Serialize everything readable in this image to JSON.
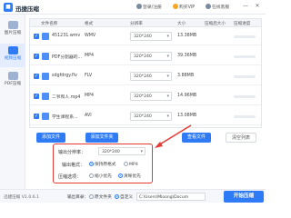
{
  "app": {
    "logo_glyph": "■",
    "title": "迅捷压缩",
    "actions": [
      "登录/注册",
      "购买VIP",
      "在线客服"
    ],
    "win_min": "—",
    "win_close": "✕"
  },
  "sidebar": {
    "items": [
      {
        "label": "图片压缩",
        "icon": "image-icon",
        "active": false
      },
      {
        "label": "视频压缩",
        "icon": "video-icon",
        "active": true
      },
      {
        "label": "PDF压缩",
        "icon": "pdf-icon",
        "active": false
      }
    ]
  },
  "table": {
    "headers": [
      "文件名称",
      "格式",
      "分辨率",
      "大小",
      "压缩后大小",
      "压缩进度"
    ],
    "rows": [
      {
        "check": "✓",
        "name": "451231.wmv",
        "format": "WMV",
        "resolution": "320*240",
        "size": "13.38MB"
      },
      {
        "check": "✓",
        "name": "PDF分割器的...",
        "format": "MP4",
        "resolution": "320*240",
        "size": "39.36MB"
      },
      {
        "check": "✓",
        "name": "sdgfdrgy.flv",
        "format": "FLV",
        "resolution": "320*240",
        "size": "3.88MB"
      },
      {
        "check": "✓",
        "name": "二爷和人.mp4",
        "format": "MP4",
        "resolution": "320*240",
        "size": "14.96MB"
      },
      {
        "check": "✓",
        "name": "学生课程系...",
        "format": "AVI",
        "resolution": "320*240",
        "size": "13.08MB"
      }
    ],
    "dropdown_arrow": "▾"
  },
  "buttons": {
    "add_file": "添加文件",
    "add_folder": "添加文件夹",
    "view_file": "查看文件",
    "clear_list": "清空列表"
  },
  "settings": {
    "resolution_label": "输出分辨率：",
    "resolution_value": "320*240",
    "format_label": "输出格式：",
    "format_options": [
      {
        "label": "保持原格式",
        "selected": true
      },
      {
        "label": "MP4",
        "selected": false
      }
    ],
    "compress_label": "压缩选项：",
    "compress_options": [
      {
        "label": "缩小优先",
        "selected": false
      },
      {
        "label": "清晰优先",
        "selected": true
      }
    ],
    "dropdown_arrow": "▾",
    "highlight_color": "#e53935"
  },
  "footer": {
    "version": "迅捷压缩 V1.0.6.1",
    "output_label": "输出目录：",
    "option_original": "原文件夹",
    "option_custom": "自定义",
    "path": "C:\\Users\\Mloong\\Docum",
    "start_button": "开始压缩"
  },
  "colors": {
    "accent": "#2f7bf5",
    "alert": "#e53935"
  }
}
